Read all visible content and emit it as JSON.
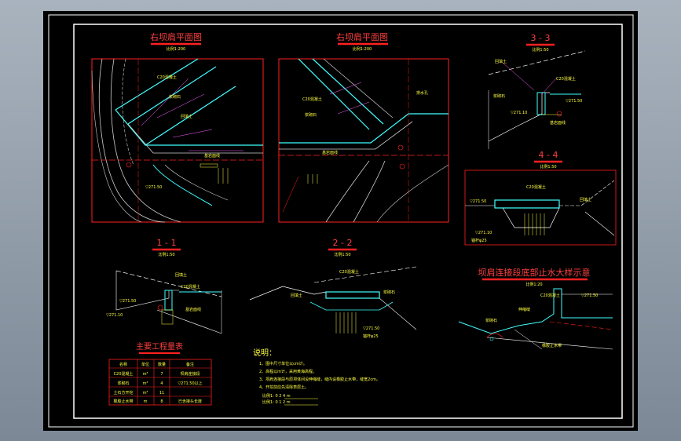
{
  "colors": {
    "background": "#a9b3be",
    "sheet": "#000000",
    "frame": "#ffffff",
    "red": "#ff2020",
    "yellow": "#ffff40",
    "cyan": "#40ffff",
    "magenta": "#ff60ff",
    "green": "#40ff40"
  },
  "titles": {
    "left_plan": "右坝肩平面图",
    "left_plan_scale": "比例1:200",
    "right_plan": "右坝肩平面图",
    "right_plan_scale": "比例1:200",
    "sec33": "3 - 3",
    "sec33_scale": "比例1:50",
    "sec44": "4 - 4",
    "sec44_scale": "比例1:50",
    "sec11": "1 - 1",
    "sec11_scale": "比例1:50",
    "sec22": "2 - 2",
    "sec22_scale": "比例1:50",
    "waterstop": "坝肩连接段底部止水大样示意",
    "waterstop_scale": "比例1:20",
    "quantity": "主要工程量表",
    "notes": "说明："
  },
  "annotations": {
    "concrete": "C20混凝土",
    "backfill": "回填土",
    "grout": "浆砌石",
    "rock": "基岩面线",
    "drain": "排水孔",
    "anchor": "锚杆φ25",
    "elev1": "▽271.50",
    "elev2": "▽271.10",
    "joint": "伸缩缝",
    "waterstop_strip": "橡胶止水带"
  },
  "quantity_table": {
    "headers": [
      "名称",
      "单位",
      "数量",
      "备注"
    ],
    "rows": [
      [
        "C20混凝土",
        "m³",
        "7",
        "坝肩连接段"
      ],
      [
        "浆砌石",
        "m³",
        "4",
        "▽271.50以上"
      ],
      [
        "土石方开挖",
        "m³",
        "11",
        ""
      ],
      [
        "橡胶止水带",
        "m",
        "8",
        "已含接头长度"
      ]
    ]
  },
  "notes": [
    "1、图中尺寸单位以cm计。",
    "2、高程以m计，采用黄海高程。",
    "3、坝肩连接段与原坝体间设伸缩缝，缝内设橡胶止水带，缝宽2cm。",
    "4、开挖前应先清除表层土。"
  ],
  "scale_bars": {
    "bar1": "比例1:  0   2   4  m",
    "bar2": "比例1:  0   1   2  m"
  }
}
